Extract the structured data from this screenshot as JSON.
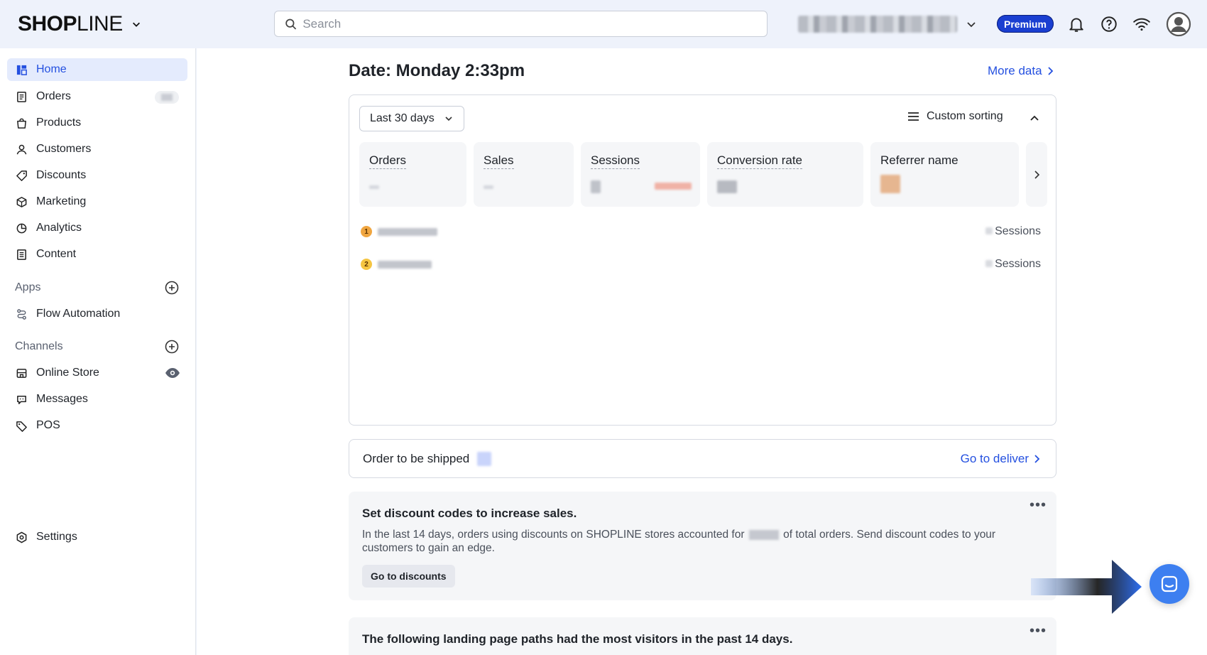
{
  "brand": {
    "logo_shop": "SHOP",
    "logo_line": "LINE"
  },
  "search": {
    "placeholder": "Search"
  },
  "header": {
    "plan_badge": "Premium"
  },
  "sidebar": {
    "items": [
      {
        "label": "Home",
        "icon": "home-icon",
        "active": true
      },
      {
        "label": "Orders",
        "icon": "orders-icon"
      },
      {
        "label": "Products",
        "icon": "bag-icon"
      },
      {
        "label": "Customers",
        "icon": "person-icon"
      },
      {
        "label": "Discounts",
        "icon": "tag-icon"
      },
      {
        "label": "Marketing",
        "icon": "cube-icon"
      },
      {
        "label": "Analytics",
        "icon": "pie-icon"
      },
      {
        "label": "Content",
        "icon": "document-icon"
      }
    ],
    "apps_label": "Apps",
    "apps": [
      {
        "label": "Flow Automation",
        "icon": "flow-icon"
      }
    ],
    "channels_label": "Channels",
    "channels": [
      {
        "label": "Online Store",
        "icon": "store-icon"
      },
      {
        "label": "Messages",
        "icon": "chat-icon"
      },
      {
        "label": "POS",
        "icon": "pos-tag-icon"
      }
    ],
    "settings_label": "Settings"
  },
  "main": {
    "title": "Date: Monday 2:33pm",
    "more_data": "More data",
    "date_range": "Last 30 days",
    "custom_sorting": "Custom sorting",
    "metrics": [
      "Orders",
      "Sales",
      "Sessions",
      "Conversion rate",
      "Referrer name"
    ],
    "referrers": [
      {
        "rank": "1",
        "sessions_label": "Sessions",
        "badge_color": "#f0a640"
      },
      {
        "rank": "2",
        "sessions_label": "Sessions",
        "badge_color": "#f5c542"
      }
    ],
    "ship": {
      "label": "Order to be shipped",
      "action": "Go to deliver"
    },
    "tip1": {
      "title": "Set discount codes to increase sales.",
      "body_before": "In the last 14 days, orders using discounts on SHOPLINE stores accounted for",
      "body_after": "of total orders. Send discount codes to your customers to gain an edge.",
      "button": "Go to discounts"
    },
    "tip2": {
      "title": "The following landing page paths had the most visitors in the past 14 days."
    }
  },
  "colors": {
    "accent": "#2450e0",
    "premium": "#1a3fd1",
    "help_button": "#3d7ff0",
    "active_bg": "#e4ebfd"
  }
}
